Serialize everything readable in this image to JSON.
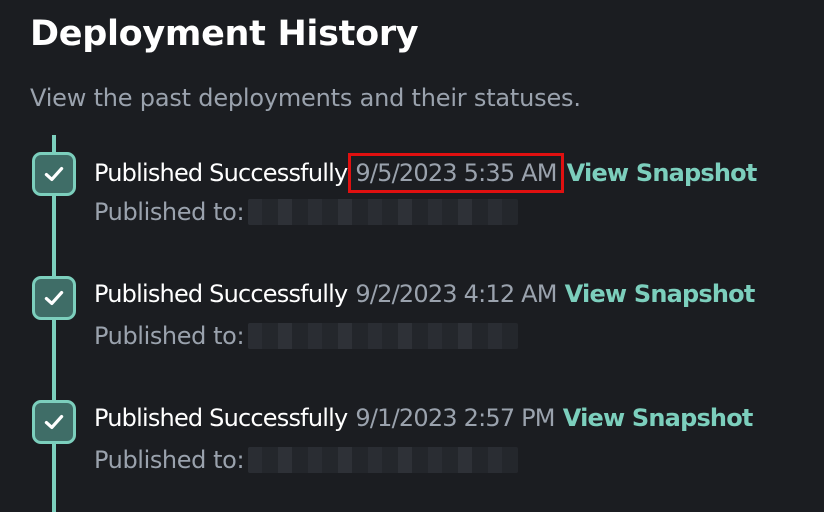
{
  "header": {
    "title": "Deployment History",
    "subtitle": "View the past deployments and their statuses."
  },
  "entries": [
    {
      "status": "Published Successfully",
      "timestamp": "9/5/2023 5:35 AM",
      "link_label": "View Snapshot",
      "published_label": "Published to:",
      "highlighted": true
    },
    {
      "status": "Published Successfully",
      "timestamp": "9/2/2023 4:12 AM",
      "link_label": "View Snapshot",
      "published_label": "Published to:",
      "highlighted": false
    },
    {
      "status": "Published Successfully",
      "timestamp": "9/1/2023 2:57 PM",
      "link_label": "View Snapshot",
      "published_label": "Published to:",
      "highlighted": false
    }
  ],
  "icons": {
    "status": "check-icon"
  },
  "colors": {
    "background": "#1b1d21",
    "accent": "#7ccfbd",
    "check_fill": "#3f6d67",
    "highlight": "#e01010",
    "muted_text": "#9aa2ad"
  }
}
